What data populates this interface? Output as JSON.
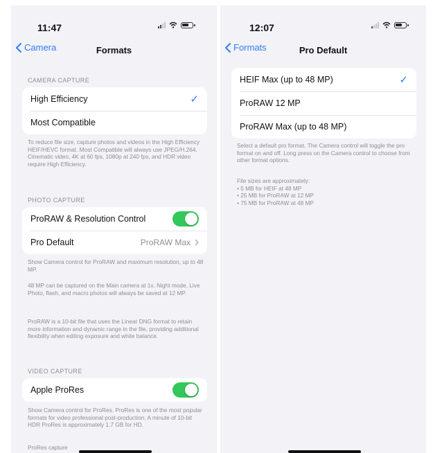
{
  "left": {
    "status": {
      "time": "11:47"
    },
    "nav": {
      "back_label": "Camera",
      "title": "Formats"
    },
    "camera_capture": {
      "header": "CAMERA CAPTURE",
      "options": [
        "High Efficiency",
        "Most Compatible"
      ],
      "selected": "High Efficiency",
      "footer": "To reduce file size, capture photos and videos in the High Efficiency HEIF/HEVC format. Most Compatible will always use JPEG/H.264. Cinematic video, 4K at 60 fps, 1080p at 240 fps, and HDR video require High Efficiency."
    },
    "photo_capture": {
      "header": "PHOTO CAPTURE",
      "proraw_label": "ProRAW & Resolution Control",
      "proraw_on": true,
      "pro_default_label": "Pro Default",
      "pro_default_value": "ProRAW Max",
      "footer1": "Show Camera control for ProRAW and maximum resolution, up to 48 MP.",
      "footer2": "48 MP can be captured on the Main camera at 1x. Night mode, Live Photo, flash, and macro photos will always be saved at 12 MP.",
      "footer3": "ProRAW is a 10-bit file that uses the Linear DNG format to retain more information and dynamic range in the file, providing additional flexibility when editing exposure and white balance."
    },
    "video_capture": {
      "header": "VIDEO CAPTURE",
      "prores_label": "Apple ProRes",
      "prores_on": true,
      "footer1": "Show Camera control for ProRes. ProRes is one of the most popular formats for video professional post-production. A minute of 10-bit HDR ProRes is approximately 1.7 GB for HD.",
      "footer2": "ProRes capture"
    }
  },
  "right": {
    "status": {
      "time": "12:07"
    },
    "nav": {
      "back_label": "Formats",
      "title": "Pro Default"
    },
    "options": [
      "HEIF Max (up to 48 MP)",
      "ProRAW 12 MP",
      "ProRAW Max (up to 48 MP)"
    ],
    "selected": "HEIF Max (up to 48 MP)",
    "footer": "Select a default pro format. The Camera control will toggle the pro format on and off. Long press on the Camera control to choose from other format options.",
    "sizes_title": "File sizes are approximately:",
    "sizes": [
      "• 5 MB for HEIF at 48 MP",
      "• 25 MB for ProRAW at 12 MP",
      "• 75 MB for ProRAW at 48 MP"
    ]
  },
  "colors": {
    "accent": "#2f7cf6",
    "toggle_on": "#34c759",
    "background": "#f2f2f7"
  },
  "icons": [
    "chevron-left-icon",
    "checkmark-icon",
    "chevron-right-icon",
    "signal-icon",
    "wifi-icon",
    "battery-icon"
  ]
}
